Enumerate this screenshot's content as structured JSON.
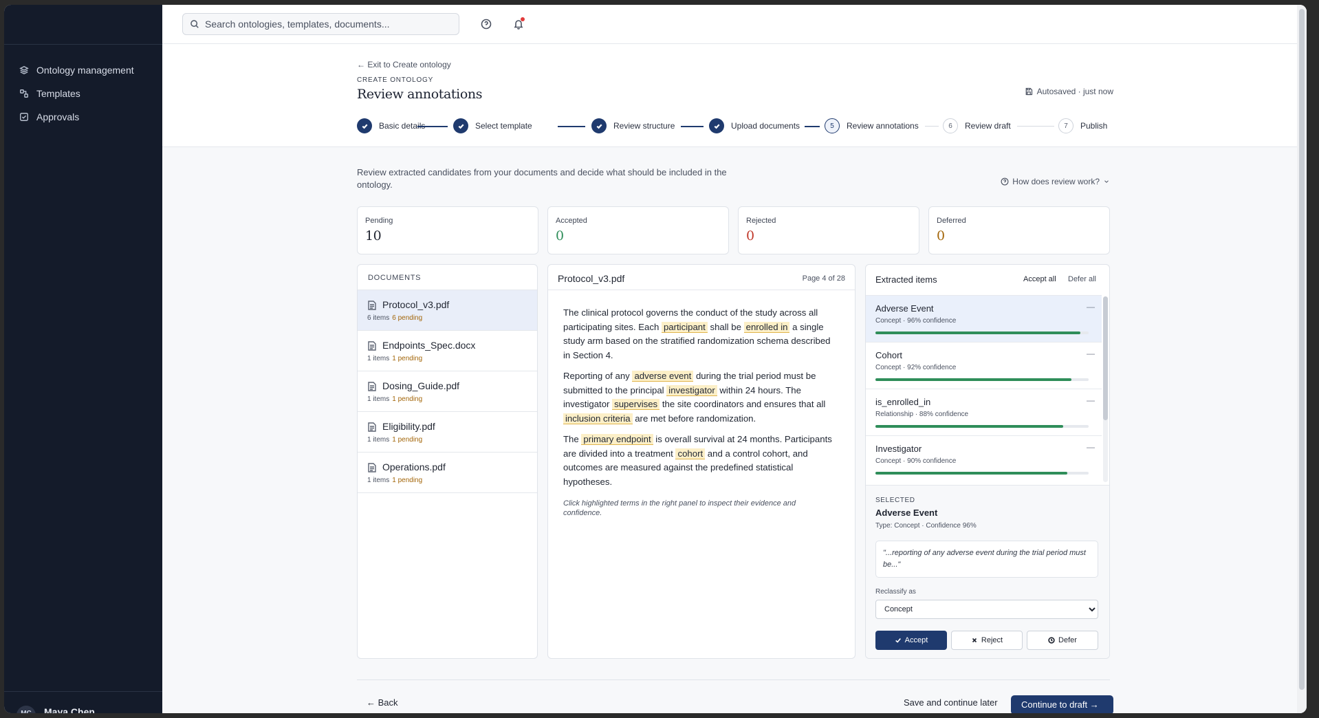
{
  "sidebar": {
    "items": [
      {
        "label": "Ontology management"
      },
      {
        "label": "Templates"
      },
      {
        "label": "Approvals"
      }
    ],
    "user": {
      "initials": "MC",
      "name": "Maya Chen"
    }
  },
  "topbar": {
    "search_placeholder": "Search ontologies, templates, documents..."
  },
  "header": {
    "exit_link": "Exit to Create ontology",
    "eyebrow": "CREATE ONTOLOGY",
    "title": "Review annotations",
    "autosave": "Autosaved · just now",
    "steps": [
      {
        "num": "1",
        "label": "Basic details",
        "state": "done"
      },
      {
        "num": "2",
        "label": "Select template",
        "state": "done"
      },
      {
        "num": "3",
        "label": "Review structure",
        "state": "done"
      },
      {
        "num": "4",
        "label": "Upload documents",
        "state": "done"
      },
      {
        "num": "5",
        "label": "Review annotations",
        "state": "active"
      },
      {
        "num": "6",
        "label": "Review draft",
        "state": "todo"
      },
      {
        "num": "7",
        "label": "Publish",
        "state": "todo"
      }
    ]
  },
  "intro": "Review extracted candidates from your documents and decide what should be included in the ontology.",
  "how_link": "How does review work?",
  "stats": [
    {
      "label": "Pending",
      "value": "10",
      "color": "#1f2430"
    },
    {
      "label": "Accepted",
      "value": "0",
      "color": "#2f8e5a"
    },
    {
      "label": "Rejected",
      "value": "0",
      "color": "#c0392b"
    },
    {
      "label": "Deferred",
      "value": "0",
      "color": "#a3660a"
    }
  ],
  "documents": {
    "heading": "DOCUMENTS",
    "items": [
      {
        "name": "Protocol_v3.pdf",
        "items": "6 items",
        "pending": "6 pending"
      },
      {
        "name": "Endpoints_Spec.docx",
        "items": "1 items",
        "pending": "1 pending"
      },
      {
        "name": "Dosing_Guide.pdf",
        "items": "1 items",
        "pending": "1 pending"
      },
      {
        "name": "Eligibility.pdf",
        "items": "1 items",
        "pending": "1 pending"
      },
      {
        "name": "Operations.pdf",
        "items": "1 items",
        "pending": "1 pending"
      }
    ]
  },
  "viewer": {
    "filename": "Protocol_v3.pdf",
    "page": "Page 4 of 28",
    "p1": {
      "a": "The clinical protocol governs the conduct of the study across all participating sites. Each ",
      "h1": "participant",
      "b": " shall be ",
      "h2": "enrolled in",
      "c": " a single study arm based on the stratified randomization schema described in Section 4."
    },
    "p2": {
      "a": "Reporting of any ",
      "h1": "adverse event",
      "b": " during the trial period must be submitted to the principal ",
      "h2": "investigator",
      "c": " within 24 hours. The investigator ",
      "h3": "supervises",
      "d": " the site coordinators and ensures that all ",
      "h4": "inclusion criteria",
      "e": " are met before randomization."
    },
    "p3": {
      "a": "The ",
      "h1": "primary endpoint",
      "b": " is overall survival at 24 months. Participants are divided into a treatment ",
      "h2": "cohort",
      "c": " and a control cohort, and outcomes are measured against the predefined statistical hypotheses."
    },
    "hint": "Click highlighted terms in the right panel to inspect their evidence and confidence."
  },
  "extracted": {
    "title": "Extracted items",
    "accept_all": "Accept all",
    "defer_all": "Defer all",
    "items": [
      {
        "name": "Adverse Event",
        "meta": "Concept · 96% confidence",
        "confidence": 0.96
      },
      {
        "name": "Cohort",
        "meta": "Concept · 92% confidence",
        "confidence": 0.92
      },
      {
        "name": "is_enrolled_in",
        "meta": "Relationship · 88% confidence",
        "confidence": 0.88
      },
      {
        "name": "Investigator",
        "meta": "Concept · 90% confidence",
        "confidence": 0.9
      }
    ],
    "selected": {
      "label": "SELECTED",
      "name": "Adverse Event",
      "sub": "Type: Concept · Confidence 96%",
      "quote": "\"...reporting of any adverse event during the trial period must be...\"",
      "reclassify_label": "Reclassify as",
      "reclassify_value": "Concept",
      "accept": "Accept",
      "reject": "Reject",
      "defer": "Defer"
    }
  },
  "footer": {
    "back": "Back",
    "save_later": "Save and continue later",
    "continue": "Continue to draft →"
  }
}
